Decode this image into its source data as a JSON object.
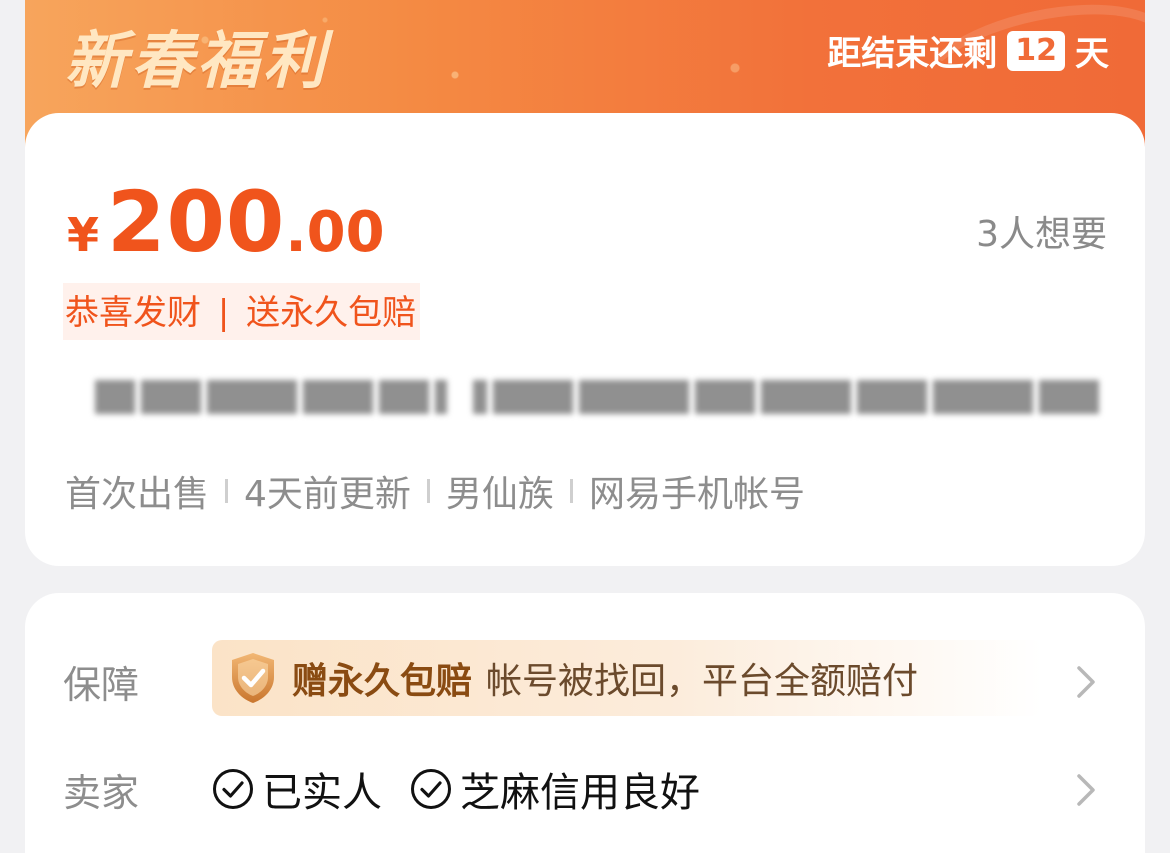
{
  "banner": {
    "title": "新春福利",
    "countdown_prefix": "距结束还剩",
    "countdown_days": "12",
    "countdown_suffix": "天"
  },
  "listing": {
    "currency": "¥",
    "price_integer": "200",
    "price_decimal": ".00",
    "wants": "3人想要",
    "promo_left": "恭喜发财",
    "promo_sep": "|",
    "promo_right": "送永久包赔",
    "meta": [
      "首次出售",
      "4天前更新",
      "男仙族",
      "网易手机帐号"
    ]
  },
  "guarantee": {
    "label": "保障",
    "highlight": "赠永久包赔",
    "description": "帐号被找回，平台全额赔付"
  },
  "seller": {
    "label": "卖家",
    "badges": [
      "已实人",
      "芝麻信用良好"
    ]
  },
  "icons": {
    "shield": "shield-check-icon",
    "check": "check-circle-icon",
    "chevron": "chevron-right-icon"
  },
  "colors": {
    "accent": "#f0541c",
    "banner_start": "#f7a55c",
    "banner_end": "#f06a37",
    "muted_text": "#8d8d8d"
  }
}
